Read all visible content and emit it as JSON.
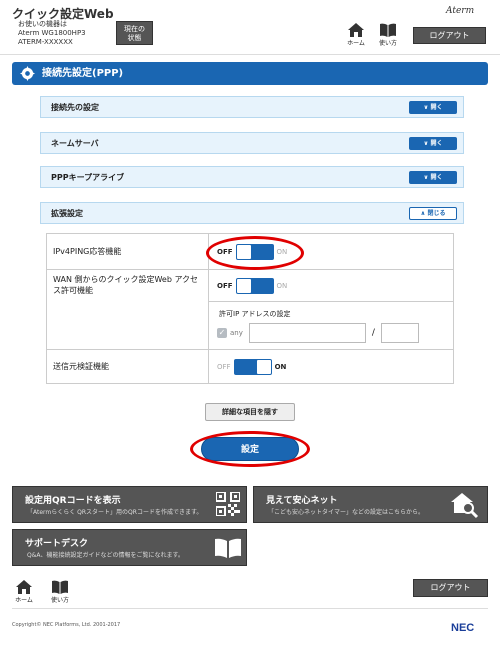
{
  "header": {
    "app_title": "クイック設定Web",
    "device_line1": "お使いの機器は",
    "device_line2": "Aterm WG1800HP3",
    "device_line3": "ATERM-XXXXXX",
    "status_button_line1": "現在の",
    "status_button_line2": "状態",
    "brand": "Aterm",
    "home_label": "ホーム",
    "manual_label": "使い方",
    "logout_label": "ログアウト"
  },
  "section": {
    "title": "接続先設定(PPP)"
  },
  "accordions": [
    {
      "label": "接続先の設定",
      "button": "開く"
    },
    {
      "label": "ネームサーバ",
      "button": "開く"
    },
    {
      "label": "PPPキープアライブ",
      "button": "開く"
    },
    {
      "label": "拡張設定",
      "button": "閉じる"
    }
  ],
  "settings": {
    "ipv4ping": {
      "label": "IPv4PING応答機能",
      "off": "OFF",
      "on": "ON",
      "state": "off"
    },
    "wan_access": {
      "label": "WAN 側からのクイック設定Web アクセス許可機能",
      "off": "OFF",
      "on": "ON",
      "state": "off"
    },
    "allowed_ip": {
      "title": "許可IP アドレスの設定",
      "any_label": "any",
      "any_checked": true,
      "ip_value": "",
      "mask_value": "",
      "separator": "/"
    },
    "source_check": {
      "label": "送信元検証機能",
      "off": "OFF",
      "on": "ON",
      "state": "on"
    }
  },
  "buttons": {
    "hide_details": "詳細な項目を隠す",
    "apply": "設定"
  },
  "panels": {
    "qr": {
      "title": "設定用QRコードを表示",
      "desc": "「Atermらくらく QRスタート」用のQRコードを作成できます。"
    },
    "safety": {
      "title": "見えて安心ネット",
      "desc": "「こども安心ネットタイマー」などの設定はこちらから。"
    },
    "support": {
      "title": "サポートデスク",
      "desc": "Q&A、機能接続設定ガイドなどの情報をご覧になれます。"
    }
  },
  "footer": {
    "home_label": "ホーム",
    "manual_label": "使い方",
    "logout_label": "ログアウト",
    "copyright": "Copyright© NEC Platforms, Ltd. 2001-2017",
    "brand": "NEC"
  },
  "colors": {
    "accent": "#1a66b2",
    "highlight": "#e00000",
    "panel": "#555555"
  }
}
